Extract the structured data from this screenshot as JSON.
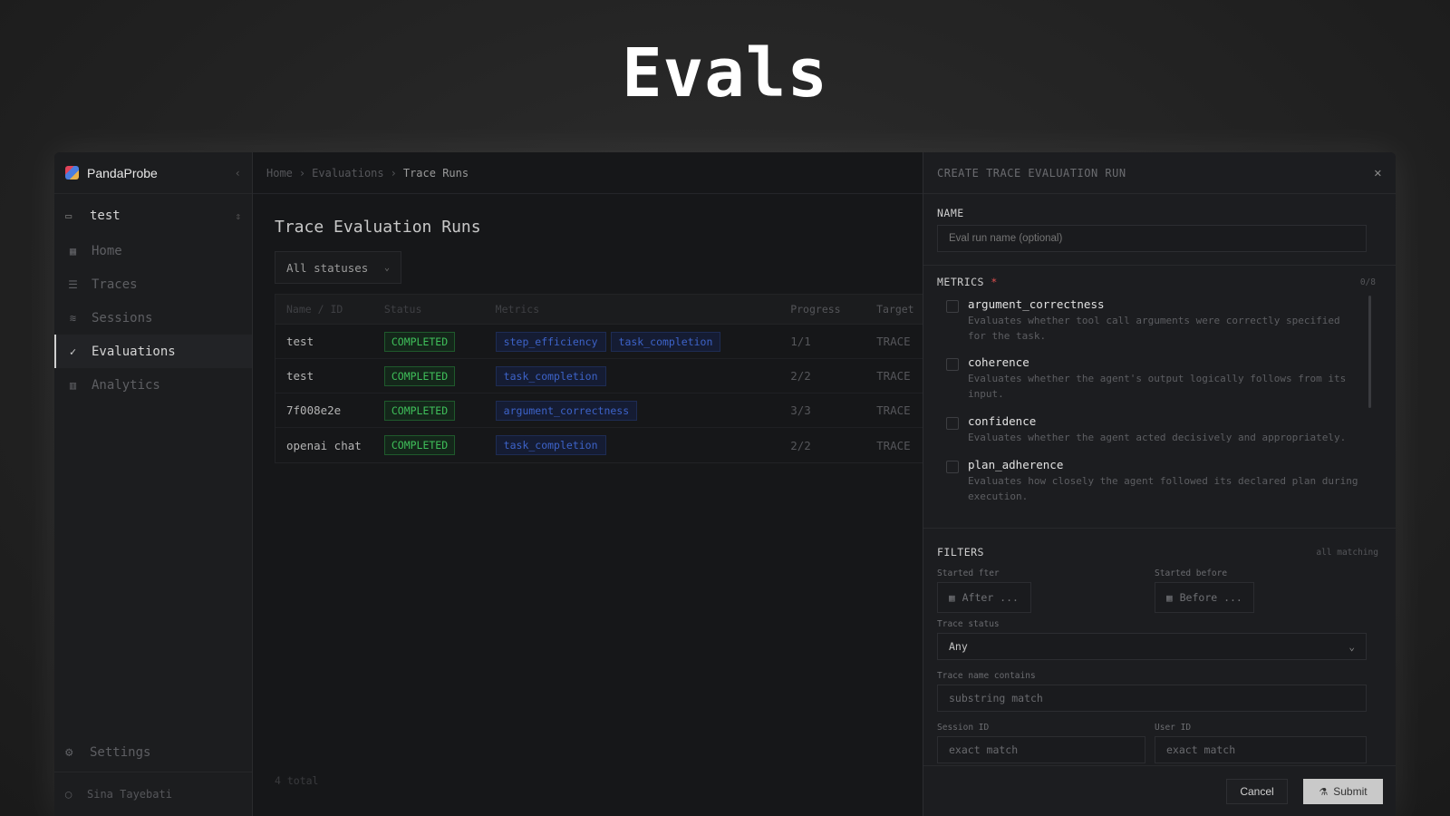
{
  "hero": {
    "title": "Evals"
  },
  "sidebar": {
    "brand": "PandaProbe",
    "project": "test",
    "items": [
      {
        "label": "Home",
        "icon": "grid-icon"
      },
      {
        "label": "Traces",
        "icon": "list-icon"
      },
      {
        "label": "Sessions",
        "icon": "layers-icon"
      },
      {
        "label": "Evaluations",
        "icon": "check-circle-icon"
      },
      {
        "label": "Analytics",
        "icon": "bar-chart-icon"
      }
    ],
    "settings": "Settings",
    "user": "Sina Tayebati"
  },
  "breadcrumb": [
    "Home",
    "Evaluations",
    "Trace Runs"
  ],
  "main": {
    "title": "Trace Evaluation Runs",
    "status_filter": "All statuses",
    "columns": [
      "Name / ID",
      "Status",
      "Metrics",
      "Progress",
      "Target"
    ],
    "rows": [
      {
        "name": "test",
        "status": "COMPLETED",
        "metrics": [
          "step_efficiency",
          "task_completion"
        ],
        "progress": "1/1",
        "target": "TRACE"
      },
      {
        "name": "test",
        "status": "COMPLETED",
        "metrics": [
          "task_completion"
        ],
        "progress": "2/2",
        "target": "TRACE"
      },
      {
        "name": "7f008e2e",
        "status": "COMPLETED",
        "metrics": [
          "argument_correctness"
        ],
        "progress": "3/3",
        "target": "TRACE"
      },
      {
        "name": "openai chat",
        "status": "COMPLETED",
        "metrics": [
          "task_completion"
        ],
        "progress": "2/2",
        "target": "TRACE"
      }
    ],
    "total": "4 total"
  },
  "panel": {
    "title": "CREATE TRACE EVALUATION RUN",
    "name_label": "NAME",
    "name_placeholder": "Eval run name (optional)",
    "metrics_label": "METRICS",
    "required_mark": "*",
    "metrics_count": "0/8",
    "metrics": [
      {
        "name": "argument_correctness",
        "desc": "Evaluates whether tool call arguments were correctly specified for the task."
      },
      {
        "name": "coherence",
        "desc": "Evaluates whether the agent's output logically follows from its input."
      },
      {
        "name": "confidence",
        "desc": "Evaluates whether the agent acted decisively and appropriately."
      },
      {
        "name": "plan_adherence",
        "desc": "Evaluates how closely the agent followed its declared plan during execution."
      }
    ],
    "filters_label": "FILTERS",
    "filters_note": "all matching",
    "started_after_label": "Started fter",
    "started_after_placeholder": "After ...",
    "started_before_label": "Started before",
    "started_before_placeholder": "Before ...",
    "trace_status_label": "Trace status",
    "trace_status_value": "Any",
    "trace_name_label": "Trace name contains",
    "trace_name_placeholder": "substring match",
    "session_label": "Session ID",
    "session_placeholder": "exact match",
    "user_label": "User ID",
    "user_placeholder": "exact match",
    "cancel": "Cancel",
    "submit": "Submit"
  },
  "colors": {
    "accent": "#d0d0d0",
    "success": "#3fbf5a",
    "tag": "#3d63c9",
    "required": "#e05050"
  }
}
